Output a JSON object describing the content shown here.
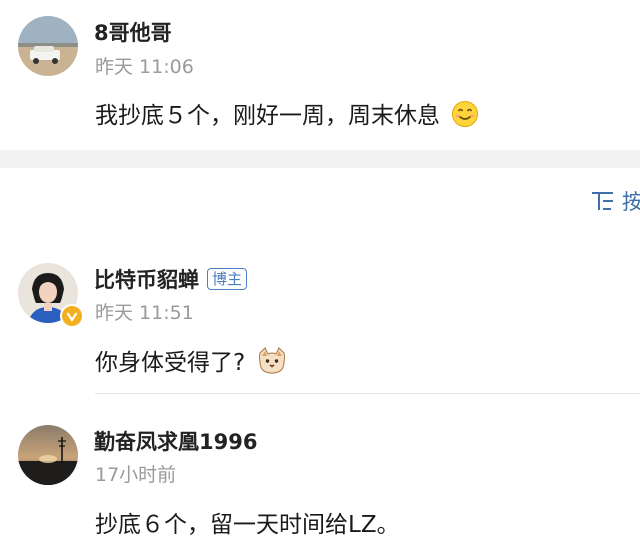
{
  "comments": [
    {
      "username": "8哥他哥",
      "timestamp": "昨天 11:06",
      "content": "我抄底５个，刚好一周，周末休息",
      "emoji": "smile-emoji"
    },
    {
      "username": "比特币貂蝉",
      "badge": "博主",
      "timestamp": "昨天 11:51",
      "content": "你身体受得了?",
      "emoji": "cat-emoji"
    },
    {
      "username": "勤奋凤求凰1996",
      "timestamp": "17小时前",
      "content": "抄底６个，留一天时间给LZ。"
    }
  ],
  "sort": {
    "label": "按"
  },
  "colors": {
    "accent": "#3f6ea8",
    "badge": "#4a7fc1",
    "timestamp": "#9a9a9a",
    "separator": "#f2f2f2"
  }
}
